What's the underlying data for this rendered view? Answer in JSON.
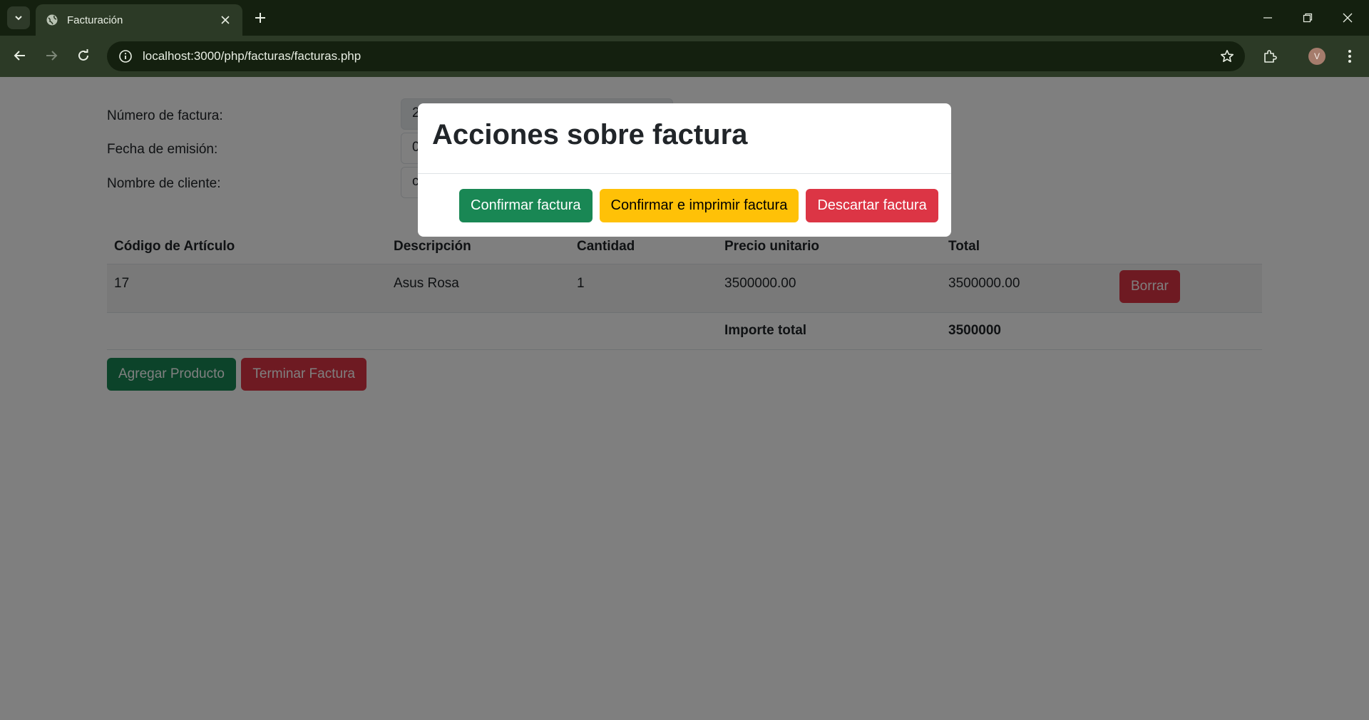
{
  "browser": {
    "tab_title": "Facturación",
    "url": "localhost:3000/php/facturas/facturas.php",
    "avatar_letter": "V"
  },
  "form": {
    "invoice_number_label": "Número de factura:",
    "invoice_number_value": "2",
    "issue_date_label": "Fecha de emisión:",
    "issue_date_value": "0",
    "client_name_label": "Nombre de cliente:",
    "client_name_value": "c"
  },
  "table": {
    "headers": [
      "Código de Artículo",
      "Descripción",
      "Cantidad",
      "Precio unitario",
      "Total",
      ""
    ],
    "rows": [
      {
        "code": "17",
        "description": "Asus Rosa",
        "quantity": "1",
        "unit_price": "3500000.00",
        "total": "3500000.00",
        "delete_label": "Borrar"
      }
    ],
    "total_label": "Importe total",
    "total_value": "3500000"
  },
  "actions": {
    "add_product_label": "Agregar Producto",
    "finish_invoice_label": "Terminar Factura"
  },
  "modal": {
    "title": "Acciones sobre factura",
    "confirm_label": "Confirmar factura",
    "confirm_print_label": "Confirmar e imprimir factura",
    "discard_label": "Descartar factura"
  },
  "colors": {
    "success": "#198754",
    "danger": "#dc3545",
    "warning": "#ffc107",
    "chrome_dark": "#14200f",
    "chrome_toolbar": "#2c3a26"
  }
}
